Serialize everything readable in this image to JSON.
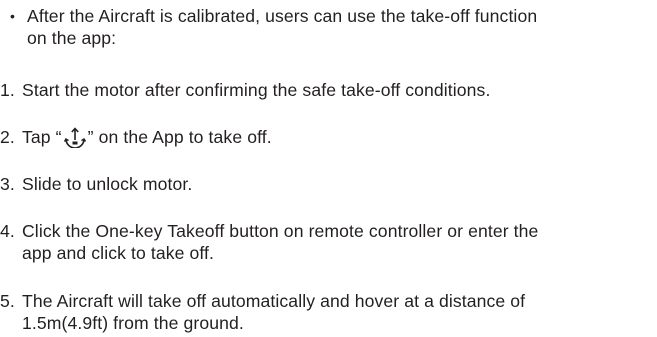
{
  "intro": {
    "bullet": "•",
    "line1": "After the Aircraft is calibrated, users can use the take-off function",
    "line2": "on the app:"
  },
  "steps": [
    {
      "num": "1.",
      "line1": "Start the motor after confirming the safe take-off conditions."
    },
    {
      "num": "2.",
      "before": "Tap “",
      "icon": "takeoff-icon",
      "after": "” on the App to take off."
    },
    {
      "num": "3.",
      "line1": "Slide to unlock motor."
    },
    {
      "num": "4.",
      "line1": "Click the One-key Takeoff button on remote controller or enter the",
      "line2": "app and click  to take off."
    },
    {
      "num": "5.",
      "line1": "The Aircraft will take off automatically and hover at a distance of",
      "line2": "1.5m(4.9ft) from the ground."
    }
  ]
}
